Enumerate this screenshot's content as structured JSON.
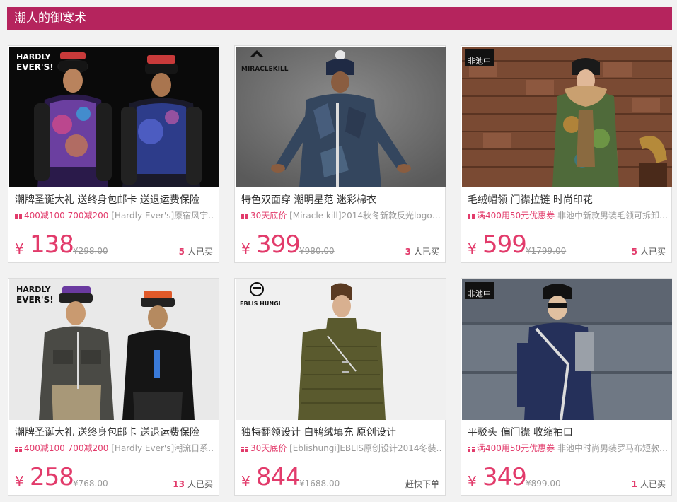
{
  "section_title": "潮人的御寒术",
  "products": [
    {
      "title": "潮牌圣诞大礼  送终身包邮卡  送退运费保险",
      "promo_tag": "400减100 700减200",
      "promo_text": " [Hardly Ever's]原宿风宇…",
      "currency": "¥",
      "price": "138",
      "original_price": "¥298.00",
      "sold_count": "5",
      "sold_label": "人已买",
      "brand_logo": "HARDLY EVER'S",
      "colors": {
        "bg": "#0b0b0b",
        "jacket": "#5b3a8c"
      }
    },
    {
      "title": "特色双面穿  潮明星范  迷彩棉衣",
      "promo_tag": "30天底价",
      "promo_text": " [Miracle kill]2014秋冬新款反光logo…",
      "currency": "¥",
      "price": "399",
      "original_price": "¥980.00",
      "sold_count": "3",
      "sold_label": "人已买",
      "brand_logo": "MIRACLEKILL",
      "colors": {
        "bg": "#7a7a7a",
        "jacket": "#3d5670"
      }
    },
    {
      "title": "毛绒帽领  门襟拉链  时尚印花",
      "promo_tag": "满400用50元优惠券",
      "promo_text": " 非池中新款男装毛领可拆卸…",
      "currency": "¥",
      "price": "599",
      "original_price": "¥1799.00",
      "sold_count": "5",
      "sold_label": "人已买",
      "brand_logo": "非池中",
      "colors": {
        "bg": "#8a5a40",
        "jacket": "#4f6a3a"
      }
    },
    {
      "title": "潮牌圣诞大礼  送终身包邮卡  送退运费保险",
      "promo_tag": "400减100 700减200",
      "promo_text": " [Hardly Ever's]潮流日系…",
      "currency": "¥",
      "price": "258",
      "original_price": "¥768.00",
      "sold_count": "13",
      "sold_label": "人已买",
      "brand_logo": "HARDLY EVER'S",
      "colors": {
        "bg": "#e8e8e8",
        "jacket": "#4a4a45"
      }
    },
    {
      "title": "独特翻领设计  白鸭绒填充  原创设计",
      "promo_tag": "30天底价",
      "promo_text": " [Eblishungi]EBLIS原创设计2014冬装…",
      "currency": "¥",
      "price": "844",
      "original_price": "¥1688.00",
      "sold_count": "",
      "sold_label": "赶快下单",
      "brand_logo": "EBLIS HUNGI",
      "colors": {
        "bg": "#efefef",
        "jacket": "#5a5a2e"
      }
    },
    {
      "title": "平驳头  偏门襟  收缩袖口",
      "promo_tag": "满400用50元优惠券",
      "promo_text": " 非池中时尚男装罗马布短款…",
      "currency": "¥",
      "price": "349",
      "original_price": "¥899.00",
      "sold_count": "1",
      "sold_label": "人已买",
      "brand_logo": "非池中",
      "colors": {
        "bg": "#6b7480",
        "jacket": "#25305a"
      }
    }
  ]
}
